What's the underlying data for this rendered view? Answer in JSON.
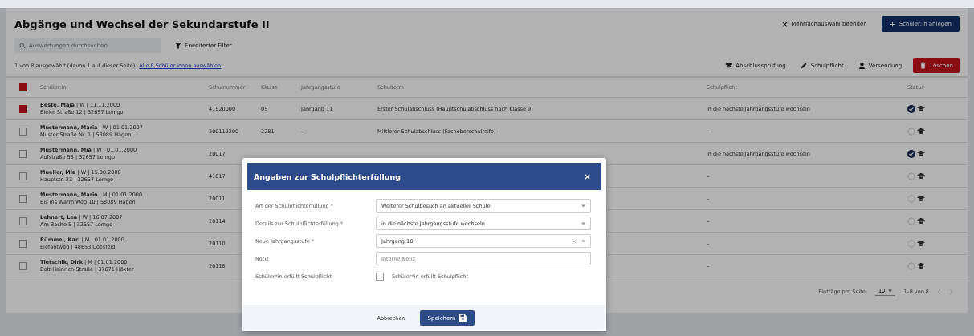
{
  "page": {
    "title": "Abgänge und Wechsel der Sekundarstufe II",
    "search": {
      "placeholder": "Auswertungen durchsuchen"
    },
    "filter_button": "Erweiterter Filter",
    "selection_info": "1 von 8 ausgewählt (davon 1 auf dieser Seite).",
    "select_all_link": "Alle 8 Schüler:innen auswählen",
    "end_multiselect_button": "Mehrfachauswahl beenden",
    "add_button": "Schüler:in anlegen",
    "actions": [
      {
        "label": "Abschlussprüfung",
        "kind": "cap"
      },
      {
        "label": "Schulpflicht",
        "kind": "pencil"
      },
      {
        "label": "Versendung",
        "kind": "person"
      },
      {
        "label": "Löschen",
        "kind": "danger"
      }
    ]
  },
  "table": {
    "header_checked": true,
    "columns": [
      "Schüler:in",
      "Schulnummer",
      "Klasse",
      "Jahrgangsstufe",
      "Schulform",
      "Schulpflicht",
      "Status"
    ],
    "rows": [
      {
        "name": "**Beste, Maja** | W | 11.11.2000",
        "address": "Bieler Straße 12 | 32657 Lemgo",
        "number": "41520000",
        "class": "05",
        "grade": "Jahrgang 11",
        "school_form": "Erster Schulabschluss (Hauptschulabschluss nach Klasse 9)",
        "duty": "in die nächste Jahrgangsstufe wechseln",
        "selected": true,
        "done": true
      },
      {
        "name": "**Mustermann, Maria** | W | 01.01.2007",
        "address": "Muster Straße Nr. 1 | 58089 Hagen",
        "number": "200112200",
        "class": "2281",
        "grade": "–",
        "school_form": "Mittlerer Schulabschluss (Fachoberschulreife)",
        "duty": "–",
        "selected": false,
        "done": false
      },
      {
        "name": "**Mustermann, Mia** | W | 01.01.2000",
        "address": "Aufstraße 53 | 32657 Lemgo",
        "number": "20017",
        "duty": "in die nächste Jahrgangsstufe wechseln",
        "selected": false,
        "done": true
      },
      {
        "name": "**Mueller, Mia** | W | 15.08.2000",
        "address": "Hauptstr. 23 | 32657 Lemgo",
        "number": "41017",
        "duty": "–",
        "selected": false,
        "done": false
      },
      {
        "name": "**Mustermann, Mario** | M | 01.01.2000",
        "address": "Bis ins Warm Weg 10 | 58089 Hagen",
        "number": "20011",
        "duty": "–",
        "selected": false,
        "done": false
      },
      {
        "name": "**Lehnert, Lea** | W | 16.07.2007",
        "address": "Am Bache 5 | 32657 Lemgo",
        "number": "20114",
        "duty": "–",
        "selected": false,
        "done": false
      },
      {
        "name": "**Rümmel, Karl** | M | 01.01.2000",
        "address": "Elefantweg | 48653 Coesfeld",
        "number": "20110",
        "duty": "–",
        "selected": false,
        "done": false
      },
      {
        "name": "**Tietschik, Dirk** | M | 01.01.2000",
        "address": "Bolt-Heinrich-Straße | 37671 Höxter",
        "number": "20118",
        "duty": "–",
        "selected": false,
        "done": false
      }
    ]
  },
  "pagination": {
    "per_page_label": "Einträge pro Seite:",
    "per_page": "10",
    "range": "1–8 von 8"
  },
  "dialog": {
    "title": "Angaben zur Schulpflichterfüllung",
    "fields": [
      {
        "label": "Art der Schulpflichterfüllung *",
        "kind": "select",
        "value": "Weiterer Schulbesuch an aktueller Schule"
      },
      {
        "label": "Details zur Schulpflichterfüllung *",
        "kind": "select",
        "value": "in die nächste Jahrgangsstufe wechseln"
      },
      {
        "label": "Neue Jahrgangsstufe *",
        "kind": "clearable",
        "value": "Jahrgang 10"
      },
      {
        "label": "Notiz",
        "kind": "text",
        "placeholder": "Interne Notiz"
      },
      {
        "label": "Schüler*in erfüllt Schulpflicht",
        "kind": "checkbox",
        "option": "Schüler*in erfüllt Schulpflicht",
        "checked": false
      }
    ],
    "cancel": "Abbrechen",
    "save": "Speichern"
  }
}
